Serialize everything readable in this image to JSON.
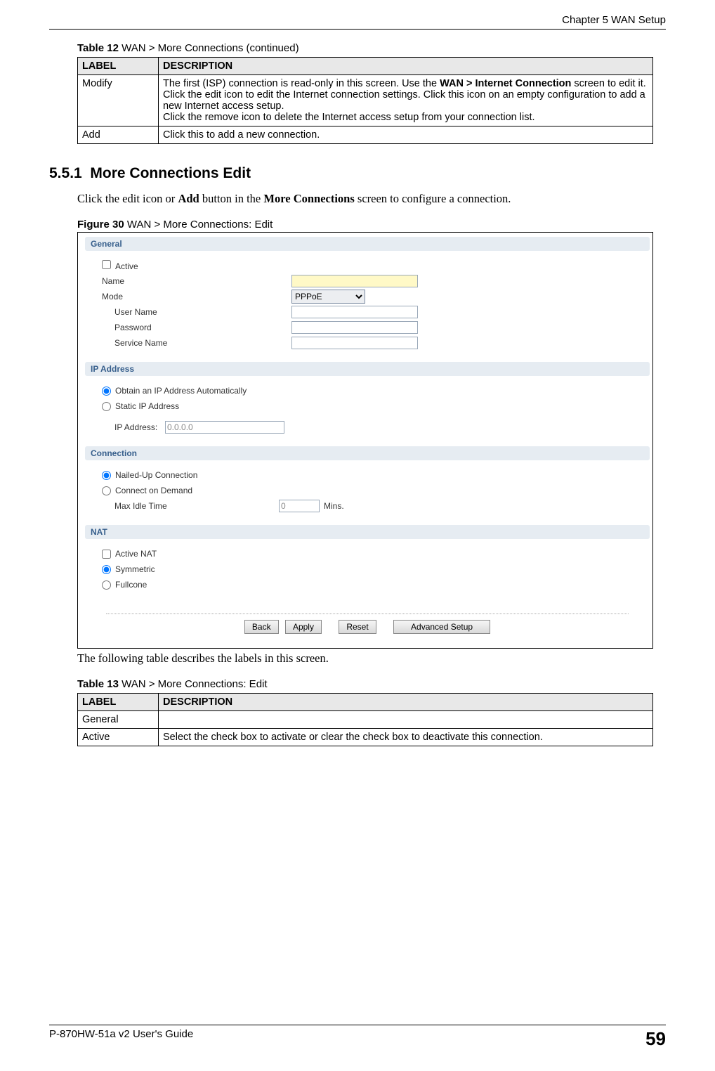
{
  "header": {
    "chapter": "Chapter 5 WAN Setup"
  },
  "table12": {
    "caption_strong": "Table 12",
    "caption_rest": "   WAN > More Connections (continued)",
    "head_label": "LABEL",
    "head_desc": "DESCRIPTION",
    "rows": [
      {
        "label": "Modify",
        "desc_line1": "The first (ISP) connection is read-only in this screen. Use the ",
        "desc_bold1": "WAN > Internet Connection",
        "desc_line1b": " screen to edit it.",
        "desc_line2": "Click the edit icon to edit the Internet connection settings. Click this icon on an empty configuration to add a new Internet access setup.",
        "desc_line3": "Click the remove icon to delete the Internet access setup from your connection list."
      },
      {
        "label": "Add",
        "desc": "Click this to add a new connection."
      }
    ]
  },
  "section": {
    "number": "5.5.1",
    "title": "More Connections Edit",
    "intro_a": "Click the edit icon or ",
    "intro_b": "Add",
    "intro_c": " button in the ",
    "intro_d": "More Connections",
    "intro_e": " screen to configure a connection."
  },
  "figure": {
    "caption_strong": "Figure 30",
    "caption_rest": "   WAN > More Connections: Edit"
  },
  "shot": {
    "general": {
      "title": "General",
      "active": "Active",
      "name": "Name",
      "mode": "Mode",
      "mode_value": "PPPoE",
      "user": "User Name",
      "pass": "Password",
      "service": "Service Name"
    },
    "ip": {
      "title": "IP Address",
      "auto": "Obtain an IP Address Automatically",
      "static": "Static IP Address",
      "addr_label": "IP Address:",
      "addr_value": "0.0.0.0"
    },
    "conn": {
      "title": "Connection",
      "nailed": "Nailed-Up Connection",
      "demand": "Connect on Demand",
      "idle_label": "Max Idle Time",
      "idle_value": "0",
      "idle_unit": "Mins."
    },
    "nat": {
      "title": "NAT",
      "active": "Active NAT",
      "sym": "Symmetric",
      "full": "Fullcone"
    },
    "buttons": {
      "back": "Back",
      "apply": "Apply",
      "reset": "Reset",
      "adv": "Advanced Setup"
    }
  },
  "after_fig": "The following table describes the labels in this screen.",
  "table13": {
    "caption_strong": "Table 13",
    "caption_rest": "   WAN > More Connections: Edit",
    "head_label": "LABEL",
    "head_desc": "DESCRIPTION",
    "rows": [
      {
        "label": "General",
        "desc": ""
      },
      {
        "label": "Active",
        "desc": "Select the check box to activate or clear the check box to deactivate this connection."
      }
    ]
  },
  "footer": {
    "guide": "P-870HW-51a v2 User's Guide",
    "page": "59"
  }
}
